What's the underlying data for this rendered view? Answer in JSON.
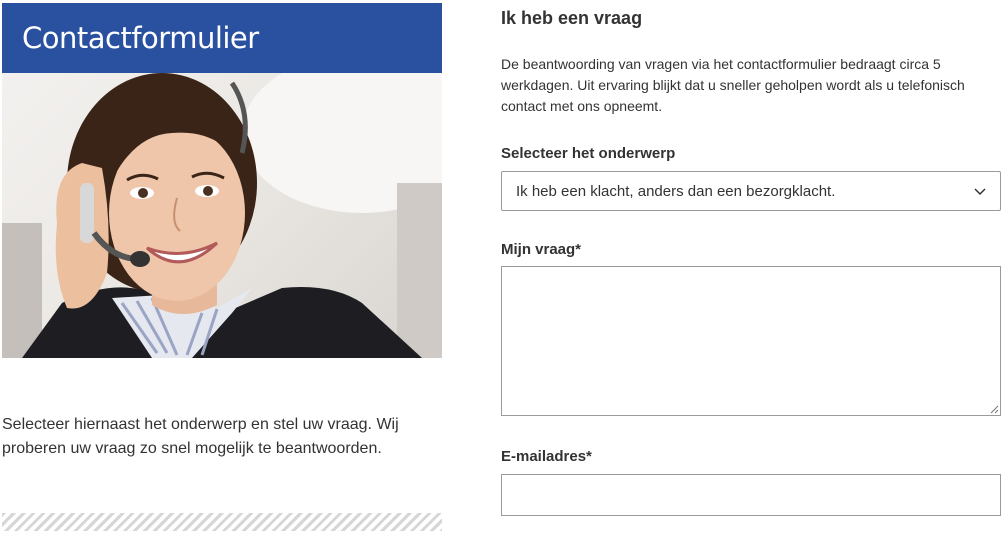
{
  "banner": {
    "title": "Contactformulier"
  },
  "intro": {
    "text": "Selecteer hiernaast het onderwerp en stel uw vraag. Wij proberen uw vraag zo snel mogelijk te beantwoorden."
  },
  "form": {
    "heading": "Ik heb een vraag",
    "description": "De beantwoording van vragen via het contactformulier bedraagt circa 5 werkdagen. Uit ervaring blijkt dat u sneller geholpen wordt als u telefonisch contact met ons opneemt.",
    "subject_label": "Selecteer het onderwerp",
    "subject_value": "Ik heb een klacht, anders dan een bezorgklacht.",
    "question_label": "Mijn vraag*",
    "question_value": "",
    "email_label": "E-mailadres*",
    "email_value": ""
  },
  "icons": {
    "select_arrow": "chevron-down-icon",
    "resize": "resize-grip-icon"
  },
  "colors": {
    "banner": "#2a50a0",
    "text": "#333333",
    "border": "#9a9a9a"
  }
}
